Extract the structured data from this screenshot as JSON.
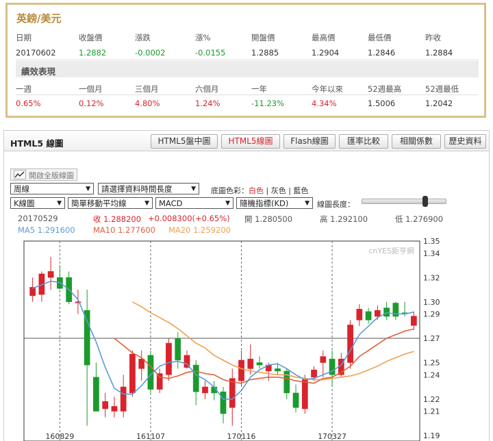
{
  "quote": {
    "title": "英鎊/美元",
    "headers": [
      "日期",
      "收盤價",
      "漲跌",
      "漲%",
      "開盤價",
      "最高價",
      "最低價",
      "昨收"
    ],
    "values": [
      "20170602",
      "1.2882",
      "-0.0002",
      "-0.0155",
      "1.2885",
      "1.2904",
      "1.2846",
      "1.2884"
    ],
    "perf_title": "績效表現",
    "perf_headers": [
      "一週",
      "一個月",
      "三個月",
      "六個月",
      "一年",
      "今年以來",
      "52週最高",
      "52週最低"
    ],
    "perf_values": [
      "0.65%",
      "0.12%",
      "4.80%",
      "1.24%",
      "-11.23%",
      "4.34%",
      "1.5006",
      "1.2042"
    ]
  },
  "chart_panel": {
    "title": "HTML5 線圖",
    "tabs": [
      "HTML5盤中圖",
      "HTML5線圖",
      "Flash線圖",
      "匯率比較",
      "相關係數",
      "歷史資料"
    ],
    "fullscreen_label": "開啟全版線圖",
    "period_select": "周線",
    "range_select": "請選擇資料時間長度",
    "bg_color_label": "底圖色彩：",
    "bg_white": "白色",
    "bg_gray": "灰色",
    "bg_blue": "藍色",
    "sep": "|",
    "candle_select": "K線圖",
    "ma_select": "簡單移動平均線",
    "macd_select": "MACD",
    "kd_select": "隨機指標(KD)",
    "length_label": "線圖長度："
  },
  "chart_info": {
    "date": "20170529",
    "close": "收 1.288200",
    "change": "+0.008300(+0.65%)",
    "open": "開 1.280500",
    "high": "高 1.292100",
    "low": "低 1.276900",
    "ma5": "MA5 1.291600",
    "ma10": "MA10 1.277600",
    "ma20": "MA20 1.259200",
    "watermark": "cnYES鉅亨網"
  },
  "colors": {
    "up": "#d9232d",
    "down": "#1b9b2e",
    "ma5": "#5b9bd5",
    "ma10": "#e0603a",
    "ma20": "#f0a050",
    "gold": "#d8c188"
  },
  "chart_data": {
    "type": "candlestick",
    "ylim": [
      1.19,
      1.35
    ],
    "yticks": [
      1.35,
      1.34,
      1.32,
      1.3,
      1.29,
      1.27,
      1.25,
      1.24,
      1.22,
      1.21,
      1.19
    ],
    "xticks": [
      {
        "label": "160829",
        "index": 3
      },
      {
        "label": "161107",
        "index": 13
      },
      {
        "label": "170116",
        "index": 23
      },
      {
        "label": "170327",
        "index": 33
      }
    ],
    "candles": [
      {
        "o": 1.305,
        "h": 1.32,
        "l": 1.3,
        "c": 1.312
      },
      {
        "o": 1.306,
        "h": 1.325,
        "l": 1.3,
        "c": 1.323
      },
      {
        "o": 1.32,
        "h": 1.337,
        "l": 1.31,
        "c": 1.325
      },
      {
        "o": 1.32,
        "h": 1.33,
        "l": 1.31,
        "c": 1.311
      },
      {
        "o": 1.32,
        "h": 1.325,
        "l": 1.298,
        "c": 1.3
      },
      {
        "o": 1.3,
        "h": 1.31,
        "l": 1.29,
        "c": 1.3
      },
      {
        "o": 1.293,
        "h": 1.31,
        "l": 1.198,
        "c": 1.248
      },
      {
        "o": 1.238,
        "h": 1.25,
        "l": 1.21,
        "c": 1.21
      },
      {
        "o": 1.212,
        "h": 1.225,
        "l": 1.205,
        "c": 1.218
      },
      {
        "o": 1.21,
        "h": 1.222,
        "l": 1.205,
        "c": 1.214
      },
      {
        "o": 1.21,
        "h": 1.24,
        "l": 1.205,
        "c": 1.23
      },
      {
        "o": 1.225,
        "h": 1.26,
        "l": 1.222,
        "c": 1.257
      },
      {
        "o": 1.245,
        "h": 1.26,
        "l": 1.235,
        "c": 1.253
      },
      {
        "o": 1.256,
        "h": 1.26,
        "l": 1.225,
        "c": 1.228
      },
      {
        "o": 1.228,
        "h": 1.245,
        "l": 1.225,
        "c": 1.241
      },
      {
        "o": 1.24,
        "h": 1.27,
        "l": 1.235,
        "c": 1.266
      },
      {
        "o": 1.27,
        "h": 1.275,
        "l": 1.245,
        "c": 1.252
      },
      {
        "o": 1.246,
        "h": 1.26,
        "l": 1.245,
        "c": 1.256
      },
      {
        "o": 1.248,
        "h": 1.252,
        "l": 1.215,
        "c": 1.226
      },
      {
        "o": 1.225,
        "h": 1.235,
        "l": 1.22,
        "c": 1.23
      },
      {
        "o": 1.23,
        "h": 1.235,
        "l": 1.219,
        "c": 1.225
      },
      {
        "o": 1.226,
        "h": 1.23,
        "l": 1.2,
        "c": 1.208
      },
      {
        "o": 1.213,
        "h": 1.245,
        "l": 1.198,
        "c": 1.237
      },
      {
        "o": 1.235,
        "h": 1.26,
        "l": 1.23,
        "c": 1.252
      },
      {
        "o": 1.245,
        "h": 1.265,
        "l": 1.24,
        "c": 1.253
      },
      {
        "o": 1.25,
        "h": 1.255,
        "l": 1.245,
        "c": 1.248
      },
      {
        "o": 1.243,
        "h": 1.25,
        "l": 1.235,
        "c": 1.248
      },
      {
        "o": 1.245,
        "h": 1.25,
        "l": 1.24,
        "c": 1.243
      },
      {
        "o": 1.243,
        "h": 1.245,
        "l": 1.22,
        "c": 1.225
      },
      {
        "o": 1.225,
        "h": 1.232,
        "l": 1.209,
        "c": 1.213
      },
      {
        "o": 1.212,
        "h": 1.24,
        "l": 1.208,
        "c": 1.236
      },
      {
        "o": 1.238,
        "h": 1.247,
        "l": 1.235,
        "c": 1.244
      },
      {
        "o": 1.25,
        "h": 1.26,
        "l": 1.238,
        "c": 1.255
      },
      {
        "o": 1.253,
        "h": 1.26,
        "l": 1.23,
        "c": 1.24
      },
      {
        "o": 1.24,
        "h": 1.258,
        "l": 1.238,
        "c": 1.253
      },
      {
        "o": 1.25,
        "h": 1.285,
        "l": 1.245,
        "c": 1.281
      },
      {
        "o": 1.285,
        "h": 1.298,
        "l": 1.28,
        "c": 1.294
      },
      {
        "o": 1.292,
        "h": 1.295,
        "l": 1.282,
        "c": 1.285
      },
      {
        "o": 1.288,
        "h": 1.297,
        "l": 1.285,
        "c": 1.293
      },
      {
        "o": 1.295,
        "h": 1.3,
        "l": 1.285,
        "c": 1.288
      },
      {
        "o": 1.299,
        "h": 1.3,
        "l": 1.285,
        "c": 1.288
      },
      {
        "o": 1.291,
        "h": 1.3,
        "l": 1.288,
        "c": 1.29
      },
      {
        "o": 1.2805,
        "h": 1.2921,
        "l": 1.2769,
        "c": 1.2882
      }
    ],
    "ma5": [
      1.311,
      1.314,
      1.317,
      1.316,
      1.31,
      1.302,
      1.284,
      1.267,
      1.246,
      1.229,
      1.224,
      1.224,
      1.231,
      1.24,
      1.247,
      1.25,
      1.251,
      1.249,
      1.24,
      1.236,
      1.23,
      1.22,
      1.22,
      1.227,
      1.238,
      1.244,
      1.248,
      1.249,
      1.245,
      1.24,
      1.236,
      1.237,
      1.24,
      1.243,
      1.248,
      1.26,
      1.273,
      1.28,
      1.287,
      1.291,
      1.29,
      1.29,
      1.2916
    ],
    "ma10": [
      null,
      null,
      null,
      null,
      null,
      null,
      null,
      null,
      null,
      1.27,
      1.264,
      1.258,
      1.254,
      1.247,
      1.238,
      1.237,
      1.239,
      1.242,
      1.243,
      1.241,
      1.24,
      1.236,
      1.234,
      1.233,
      1.236,
      1.237,
      1.238,
      1.238,
      1.237,
      1.235,
      1.234,
      1.233,
      1.237,
      1.238,
      1.242,
      1.247,
      1.255,
      1.26,
      1.265,
      1.27,
      1.273,
      1.276,
      1.2776
    ],
    "ma20": [
      null,
      null,
      null,
      null,
      null,
      null,
      null,
      null,
      null,
      null,
      null,
      1.3,
      1.296,
      1.291,
      1.287,
      1.283,
      1.278,
      1.272,
      1.266,
      1.262,
      1.256,
      1.252,
      1.248,
      1.245,
      1.243,
      1.242,
      1.241,
      1.24,
      1.24,
      1.238,
      1.237,
      1.236,
      1.236,
      1.237,
      1.238,
      1.239,
      1.241,
      1.244,
      1.247,
      1.251,
      1.254,
      1.257,
      1.2592
    ]
  }
}
